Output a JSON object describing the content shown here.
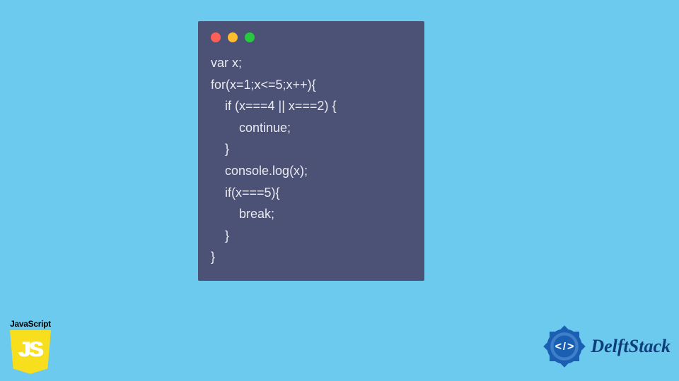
{
  "code_window": {
    "dots": [
      "red",
      "yellow",
      "green"
    ],
    "code": "var x;\nfor(x=1;x<=5;x++){\n    if (x===4 || x===2) {\n        continue;\n    }\n    console.log(x);\n    if(x===5){\n        break;\n    }\n}"
  },
  "js_badge": {
    "label": "JavaScript",
    "shield_text": "JS"
  },
  "delft": {
    "brand": "DelftStack",
    "tag_open": "<",
    "tag_slash": "/",
    "tag_close": ">"
  }
}
